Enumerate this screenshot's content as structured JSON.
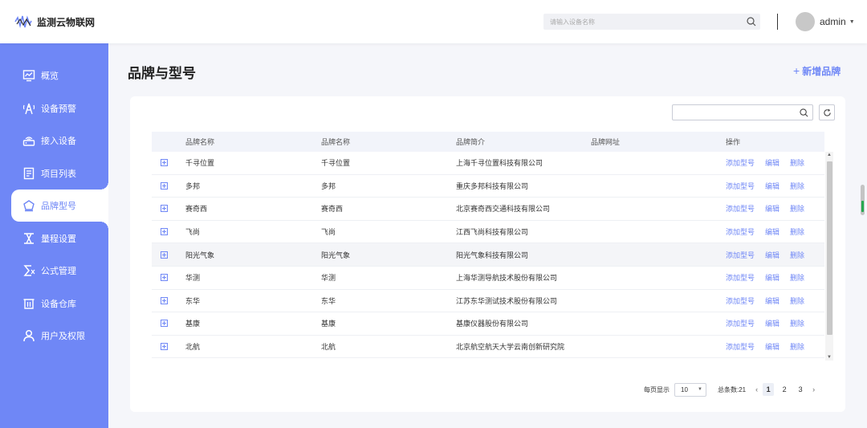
{
  "app": {
    "logo_text": "监测云物联网"
  },
  "header": {
    "search_placeholder": "请输入设备名称",
    "user_name": "admin"
  },
  "sidebar": {
    "items": [
      {
        "label": "概览",
        "icon": "chart-monitor-icon"
      },
      {
        "label": "设备预警",
        "icon": "alarm-tower-icon"
      },
      {
        "label": "接入设备",
        "icon": "router-icon"
      },
      {
        "label": "项目列表",
        "icon": "document-list-icon"
      },
      {
        "label": "品牌型号",
        "icon": "brand-badge-icon",
        "active": true
      },
      {
        "label": "量程设置",
        "icon": "range-setting-icon"
      },
      {
        "label": "公式管理",
        "icon": "formula-sigma-icon"
      },
      {
        "label": "设备仓库",
        "icon": "warehouse-icon"
      },
      {
        "label": "用户及权限",
        "icon": "user-icon"
      }
    ]
  },
  "main": {
    "title": "品牌与型号",
    "add_brand_label": "新增品牌"
  },
  "table": {
    "headers": [
      "品牌名称",
      "品牌名称",
      "品牌简介",
      "品牌网址",
      "操作"
    ],
    "actions": [
      "添加型号",
      "编辑",
      "删除"
    ],
    "rows": [
      {
        "name": "千寻位置",
        "name2": "千寻位置",
        "intro": "上海千寻位置科技有限公司",
        "url": ""
      },
      {
        "name": "多邦",
        "name2": "多邦",
        "intro": "重庆多邦科技有限公司",
        "url": ""
      },
      {
        "name": "赛奇西",
        "name2": "赛奇西",
        "intro": "北京赛奇西交通科技有限公司",
        "url": ""
      },
      {
        "name": "飞尚",
        "name2": "飞尚",
        "intro": "江西飞尚科技有限公司",
        "url": ""
      },
      {
        "name": "阳光气象",
        "name2": "阳光气象",
        "intro": "阳光气象科技有限公司",
        "url": ""
      },
      {
        "name": "华测",
        "name2": "华测",
        "intro": "上海华测导航技术股份有限公司",
        "url": ""
      },
      {
        "name": "东华",
        "name2": "东华",
        "intro": "江苏东华测试技术股份有限公司",
        "url": ""
      },
      {
        "name": "基康",
        "name2": "基康",
        "intro": "基康仪器股份有限公司",
        "url": ""
      },
      {
        "name": "北航",
        "name2": "北航",
        "intro": "北京航空航天大学云南创新研究院",
        "url": ""
      }
    ]
  },
  "pagination": {
    "per_page_label": "每页显示",
    "per_page_value": "10",
    "total_label": "总条数:21",
    "pages": [
      "1",
      "2",
      "3"
    ],
    "current": "1"
  },
  "colors": {
    "accent": "#6f87f6",
    "background": "#f5f6fa"
  }
}
